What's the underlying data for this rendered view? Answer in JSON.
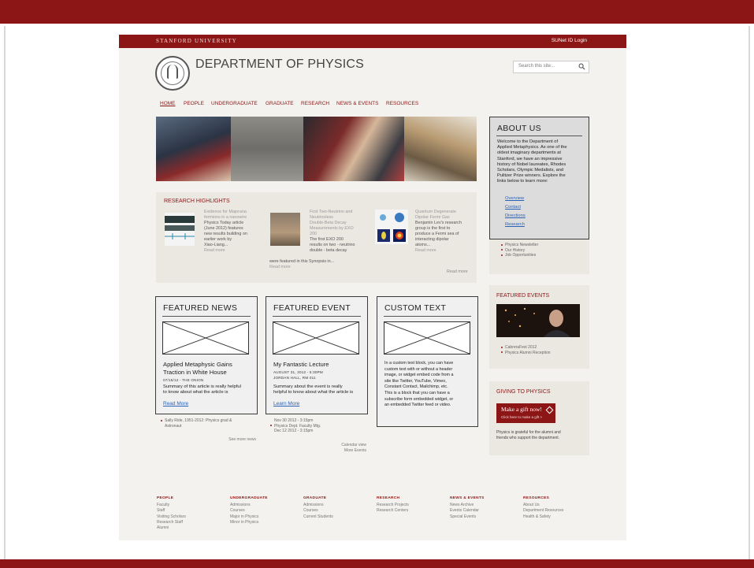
{
  "site": {
    "university": "STANFORD UNIVERSITY",
    "login": "SUNet ID Login",
    "department": "DEPARTMENT OF PHYSICS",
    "search_placeholder": "Search this site..."
  },
  "nav": [
    "HOME",
    "PEOPLE",
    "UNDERGRADUATE",
    "GRADUATE",
    "RESEARCH",
    "NEWS & EVENTS",
    "RESOURCES"
  ],
  "highlights": {
    "title": "RESEARCH HIGHLIGHTS",
    "items": [
      {
        "title": [
          "Evidence for Majorana",
          "fermions in a nanowire"
        ],
        "body": [
          "Physics Today article",
          "(June 2012) features",
          "new results building on",
          "earlier work by",
          "Xiao-Liang..."
        ],
        "more": "Read more"
      },
      {
        "title": [
          "First Two-Neutrino and",
          "Neutrinoless",
          "Double-Beta Decay",
          "Measurements by EXO",
          "200"
        ],
        "body": [
          "The first EXO 200",
          "results on two - neutrino",
          "double - beta decay"
        ],
        "wide": "were featured in this Synopsis in...",
        "more": "Read more"
      },
      {
        "title": [
          "Quantum Degenerate",
          "Dipolar Fermi Gas"
        ],
        "body": [
          "Benjamin Lev's research",
          "group is the first to",
          "produce a Fermi sea of",
          "interacting dipolar",
          "atoms..."
        ],
        "more": "Read more"
      }
    ],
    "read_more": "Read more"
  },
  "featured_news": {
    "title": "FEATURED NEWS",
    "headline": [
      "Applied Metaphysic Gains",
      "Traction in White House"
    ],
    "meta": "07/15/12 - THE ONION",
    "summary": [
      "Summary of this article is really helpful",
      "to know about what the article is"
    ],
    "link": "Read More",
    "list": [
      "Sally Ride, 1951-2012: Physics grad &",
      "Astronaut"
    ],
    "see_more": "See more news"
  },
  "featured_event": {
    "title": "FEATURED EVENT",
    "headline": "My Fantastic Lecture",
    "meta": [
      "AUGUST 31, 2012 - 5:30PM",
      "JORDAN HALL, RM 011"
    ],
    "summary": [
      "Summary about the event is really",
      "helpful to know about what the article is"
    ],
    "link": "Learn More",
    "list": [
      "Nov 30 2012 - 3:15pm",
      "Physics Dept. Faculty Mtg.",
      "Dec 12 2012 - 3:15pm"
    ],
    "calendar": "Calendar view",
    "more_events": "More Events"
  },
  "custom_text": {
    "title": "CUSTOM TEXT",
    "body": [
      "In a custom text block, you can have",
      "custom text with or without a header",
      "image, or widget embed code from a",
      "site like Twitter, YouTube, Vimeo,",
      "Constant Contact, Mailchimp, etc.",
      "This is a block that you can have a",
      "subscribe form embedded widget, or",
      "an embedded Twitter feed or video."
    ]
  },
  "about": {
    "title": "ABOUT US",
    "body": [
      "Welcome to the Department of",
      "Applied Metaphysics. As one of the",
      "oldest imaginary departments at",
      "Stanford, we have an impressive",
      "history of Nobel laureates, Rhodes",
      "Scholars, Olympic Medalists, and",
      "Pulitzer Prize winners. Explore the",
      "links below to learn more:"
    ],
    "links": [
      "Overview",
      "Contact",
      "Directions",
      "Research"
    ],
    "list": [
      "Physics Newsletter",
      "Our History",
      "Job Opportunities"
    ]
  },
  "featured_events": {
    "title": "FEATURED EVENTS",
    "list": [
      "CabreraFest 2012",
      "Physics Alumni Reception"
    ]
  },
  "giving": {
    "title": "GIVING TO PHYSICS",
    "button_main": "Make a gift now!",
    "button_sub": "Click here to make a gift >",
    "text": [
      "Physics is grateful for the alumni and",
      "friends who support the department."
    ]
  },
  "footer": [
    {
      "head": "PEOPLE",
      "items": [
        "Faculty",
        "Staff",
        "Visiting Scholars",
        "Research Staff",
        "Alumni"
      ]
    },
    {
      "head": "UNDERGRADUATE",
      "items": [
        "Admissions",
        "Courses",
        "Major in Physics",
        "Minor in Physics"
      ]
    },
    {
      "head": "GRADUATE",
      "items": [
        "Admissions",
        "Courses",
        "Current Students"
      ]
    },
    {
      "head": "RESEARCH",
      "items": [
        "Research Projects",
        "Research Centers"
      ]
    },
    {
      "head": "NEWS & EVENTS",
      "items": [
        "News Archive",
        "Events Calendar",
        "Special Events"
      ]
    },
    {
      "head": "RESOURCES",
      "items": [
        "About Us",
        "Department Resources",
        "Health & Safety"
      ]
    }
  ],
  "colors": {
    "cardinal": "#8c1515",
    "link_blue": "#2a62b8",
    "page_bg": "#f4f2ee",
    "panel_bg": "#ebe8e2"
  }
}
